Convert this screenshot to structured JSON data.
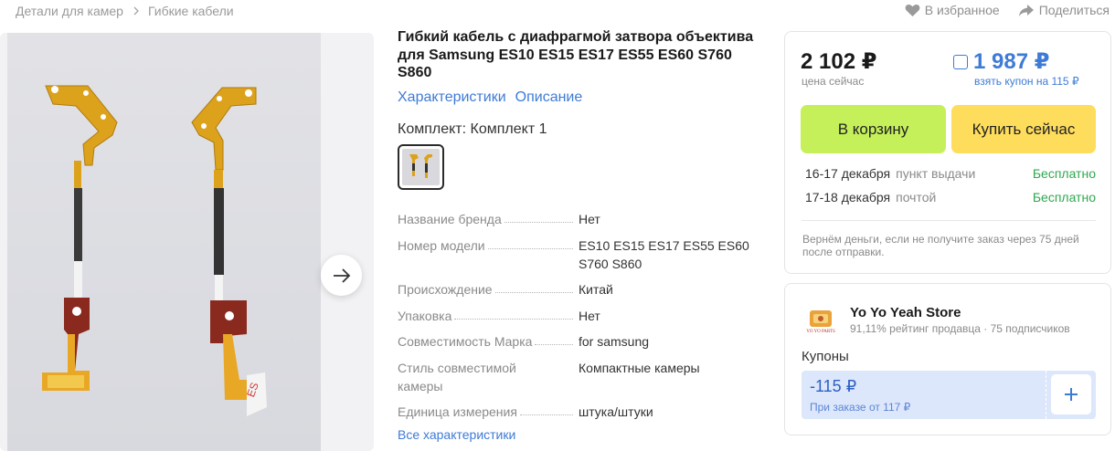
{
  "breadcrumb": {
    "items": [
      "Детали для камер",
      "Гибкие кабели"
    ]
  },
  "top_actions": {
    "favorite": "В избранное",
    "share": "Поделиться"
  },
  "product": {
    "title": "Гибкий кабель с диафрагмой затвора объектива для Samsung ES10 ES15 ES17 ES55 ES60 S760 S860",
    "tabs": [
      "Характеристики",
      "Описание"
    ],
    "kit_label": "Комплект: Комплект 1",
    "specs": [
      {
        "key": "Название бренда",
        "value": "Нет"
      },
      {
        "key": "Номер модели",
        "value": "ES10 ES15 ES17 ES55 ES60 S760 S860"
      },
      {
        "key": "Происхождение",
        "value": "Китай"
      },
      {
        "key": "Упаковка",
        "value": "Нет"
      },
      {
        "key": "Совместимость Марка",
        "value": "for samsung"
      },
      {
        "key": "Стиль совместимой камеры",
        "value": "Компактные камеры"
      },
      {
        "key": "Единица измерения",
        "value": "штука/штуки"
      }
    ],
    "all_specs_link": "Все характеристики"
  },
  "price_card": {
    "price_now": "2 102 ₽",
    "price_now_label": "цена сейчас",
    "coupon_price": "1 987 ₽",
    "coupon_label": "взять купон на 115 ₽",
    "cart_button": "В корзину",
    "buy_button": "Купить сейчас",
    "delivery": [
      {
        "date": "16-17 декабря",
        "type": "пункт выдачи",
        "price": "Бесплатно"
      },
      {
        "date": "17-18 декабря",
        "type": "почтой",
        "price": "Бесплатно"
      }
    ],
    "refund_note": "Вернём деньги, если не получите заказ через 75 дней после отправки."
  },
  "store": {
    "name": "Yo Yo Yeah Store",
    "rating": "91,11% рейтинг продавца",
    "subscribers": "75 подписчиков",
    "logo_text": "YO YO PARTS",
    "coupons_label": "Купоны",
    "coupon": {
      "amount": "-115 ₽",
      "condition": "При заказе от 117 ₽"
    }
  },
  "colors": {
    "accent_blue": "#3e7bd6",
    "cart_green": "#c5f05a",
    "buy_yellow": "#fedd5c",
    "free_green": "#2fa84f",
    "coupon_bg": "#dde7fb",
    "cable_gold": "#e3a21a"
  },
  "icons": [
    "chevron-right-icon",
    "heart-icon",
    "share-icon",
    "arrow-right-icon",
    "plus-icon"
  ]
}
